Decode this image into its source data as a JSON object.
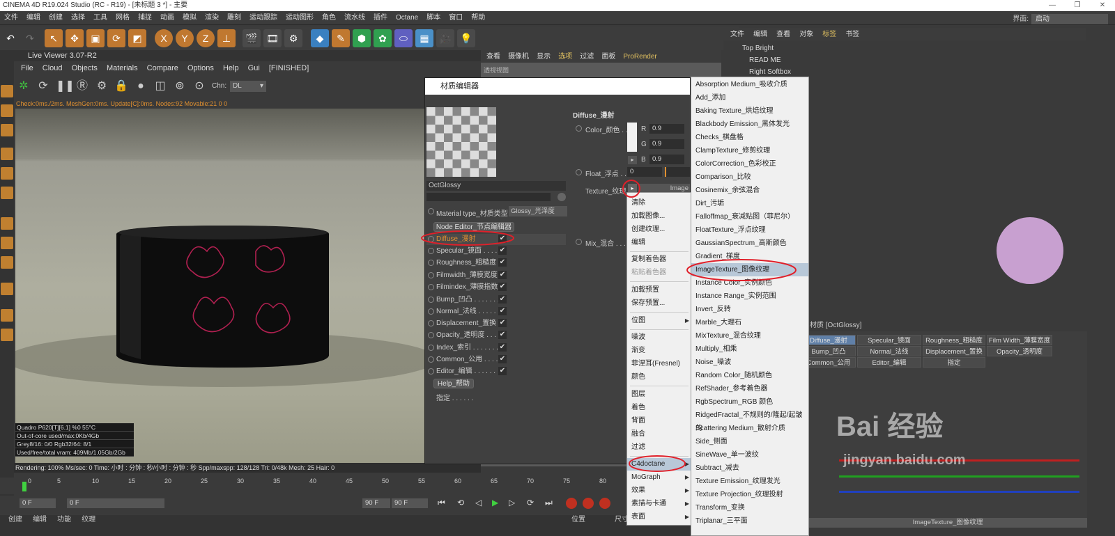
{
  "app": {
    "title": "CINEMA 4D R19.024 Studio (RC - R19) - [未标题 3 *] - 主要"
  },
  "menu": [
    "文件",
    "编辑",
    "创建",
    "选择",
    "工具",
    "网格",
    "捕捉",
    "动画",
    "模拟",
    "渲染",
    "雕刻",
    "运动跟踪",
    "运动图形",
    "角色",
    "流水线",
    "插件",
    "Octane",
    "脚本",
    "窗口",
    "帮助"
  ],
  "layout": {
    "label": "界面:",
    "value": "启动"
  },
  "toolbar": {
    "axes": [
      "X",
      "Y",
      "Z"
    ]
  },
  "live_viewer": {
    "title": "Live Viewer 3.07-R2",
    "menu": [
      "File",
      "Cloud",
      "Objects",
      "Materials",
      "Compare",
      "Options",
      "Help",
      "Gui",
      "[FINISHED]"
    ],
    "channel_label": "Chn:",
    "channel_value": "DL",
    "status": "Check:0ms./2ms. MeshGen:0ms. Update[C]:0ms. Nodes:92 Movable:21  0 0",
    "stats": [
      "Quadro P620[T][6.1]        %0     55°C",
      "Out-of-core used/max:0Kb/4Gb",
      "Grey8/16: 0/0           Rgb32/64: 8/1",
      "Used/free/total vram: 409Mb/1.05Gb/2Gb"
    ],
    "render_bar": "Rendering: 100%   Ms/sec: 0   Time: 小时 : 分钟 : 秒/小时 : 分钟 : 秒   Spp/maxspp: 128/128   Tri: 0/48k   Mesh: 25   Hair: 0"
  },
  "viewport": {
    "tabs": [
      "查看",
      "摄像机",
      "显示",
      "选项",
      "过滤",
      "面板",
      "ProRender"
    ],
    "label": "透视视图"
  },
  "material_editor": {
    "title": "材质编辑器",
    "material_name": "OctGlossy",
    "material_type_label": "Material type_材质类型",
    "material_type_value": "Glossy_光泽度",
    "node_editor": "Node Editor_节点编辑器",
    "help": "Help_帮助",
    "assign": "指定 . . . . . .",
    "channels": [
      {
        "label": "Diffuse_漫射",
        "checked": "✔"
      },
      {
        "label": "Specular_镜面 . . . . . .",
        "checked": "✔"
      },
      {
        "label": "Roughness_粗糙度 . .",
        "checked": "✔"
      },
      {
        "label": "Filmwidth_薄膜宽度 .",
        "checked": "✔"
      },
      {
        "label": "Filmindex_薄膜指数 .",
        "checked": "✔"
      },
      {
        "label": "Bump_凹凸 . . . . . . .",
        "checked": "✔"
      },
      {
        "label": "Normal_法线 . . . . . .",
        "checked": "✔"
      },
      {
        "label": "Displacement_置换 .",
        "checked": "✔"
      },
      {
        "label": "Opacity_透明度 . . . .",
        "checked": "✔"
      },
      {
        "label": "Index_索引 . . . . . . .",
        "checked": "✔"
      },
      {
        "label": "Common_公用 . . . . .",
        "checked": "✔"
      },
      {
        "label": "Editor_编辑 . . . . . .",
        "checked": "✔"
      }
    ],
    "section_title": "Diffuse_漫射",
    "color_label": "Color_颜色 . .",
    "r_label": "R",
    "r_value": "0.9",
    "g_label": "G",
    "g_value": "0.9",
    "b_label": "B",
    "b_value": "0.9",
    "float_label": "Float_浮点 . .",
    "float_value": "0",
    "texture_label": "Texture_纹理",
    "texture_btn": "Image",
    "mix_label": "Mix_混合 . . ."
  },
  "context_menu": [
    {
      "label": "清除"
    },
    {
      "label": "加载图像..."
    },
    {
      "label": "创建纹理..."
    },
    {
      "label": "编辑"
    },
    {
      "label": "复制着色器"
    },
    {
      "label": "粘贴着色器",
      "disabled": true
    },
    {
      "label": "加载预置"
    },
    {
      "label": "保存预置..."
    },
    {
      "label": "位图",
      "sub": true
    },
    {
      "label": "噪波"
    },
    {
      "label": "渐变"
    },
    {
      "label": "菲涅耳(Fresnel)"
    },
    {
      "label": "颜色"
    },
    {
      "label": "图层"
    },
    {
      "label": "着色"
    },
    {
      "label": "背面"
    },
    {
      "label": "融合"
    },
    {
      "label": "过滤"
    },
    {
      "label": "C4doctane",
      "sub": true
    },
    {
      "label": "MoGraph",
      "sub": true
    },
    {
      "label": "效果",
      "sub": true
    },
    {
      "label": "素描与卡通",
      "sub": true
    },
    {
      "label": "表面",
      "sub": true
    }
  ],
  "submenu": [
    "Absorption Medium_吸收介质",
    "Add_添加",
    "Baking Texture_烘焙纹理",
    "Blackbody Emission_黑体发光",
    "Checks_棋盘格",
    "ClampTexture_修剪纹理",
    "ColorCorrection_色彩校正",
    "Comparison_比较",
    "Cosinemix_余弦混合",
    "Dirt_污垢",
    "Falloffmap_衰减贴图（菲尼尔）",
    "FloatTexture_浮点纹理",
    "GaussianSpectrum_高斯颜色",
    "Gradient_梯度",
    "ImageTexture_图像纹理",
    "Instance Color_实例颜色",
    "Instance Range_实例范围",
    "Invert_反转",
    "Marble_大理石",
    "MixTexture_混合纹理",
    "Multiply_相乘",
    "Noise_噪波",
    "Random Color_随机颜色",
    "RefShader_参考着色器",
    "RgbSpectrum_RGB 颜色",
    "RidgedFractal_不规则的/隆起/起皱的",
    "Scattering Medium_散射介质",
    "Side_侧面",
    "SineWave_单一波纹",
    "Subtract_减去",
    "Texture Emission_纹理发光",
    "Texture Projection_纹理投射",
    "Transform_变换",
    "Triplanar_三平面"
  ],
  "object_manager": {
    "menu": [
      "文件",
      "编辑",
      "查看",
      "对象",
      "标签",
      "书签"
    ],
    "objects": [
      "Top Bright",
      "READ ME",
      "Right Softbox"
    ]
  },
  "attributes": {
    "header": "材质 [OctGlossy]",
    "tabs": [
      [
        "Diffuse_漫射",
        "Specular_镜面",
        "Roughness_粗糙度",
        "Film Width_薄膜宽度"
      ],
      [
        "Bump_凹凸",
        "Normal_法线",
        "Displacement_置换",
        "Opacity_透明度"
      ],
      [
        "Common_公用",
        "Editor_编辑",
        "指定"
      ]
    ],
    "footer": "ImageTexture_图像纹理"
  },
  "timeline": {
    "ticks": [
      "0",
      "5",
      "10",
      "15",
      "20",
      "25",
      "30",
      "35",
      "40",
      "45",
      "50",
      "55",
      "60",
      "65",
      "70",
      "75",
      "80"
    ],
    "start": "0 F",
    "current": "0 F",
    "end": "90 F",
    "max": "90 F"
  },
  "bottom": {
    "tabs": [
      "创建",
      "编辑",
      "功能",
      "纹理"
    ],
    "pos_label": "位置",
    "size_label": "尺寸"
  },
  "watermark": {
    "line1": "Bai 经验",
    "line2": "jingyan.baidu.com"
  },
  "colors": {
    "accent": "#e09030",
    "annotation": "#e0202a",
    "highlight": "#b8c8d8"
  }
}
